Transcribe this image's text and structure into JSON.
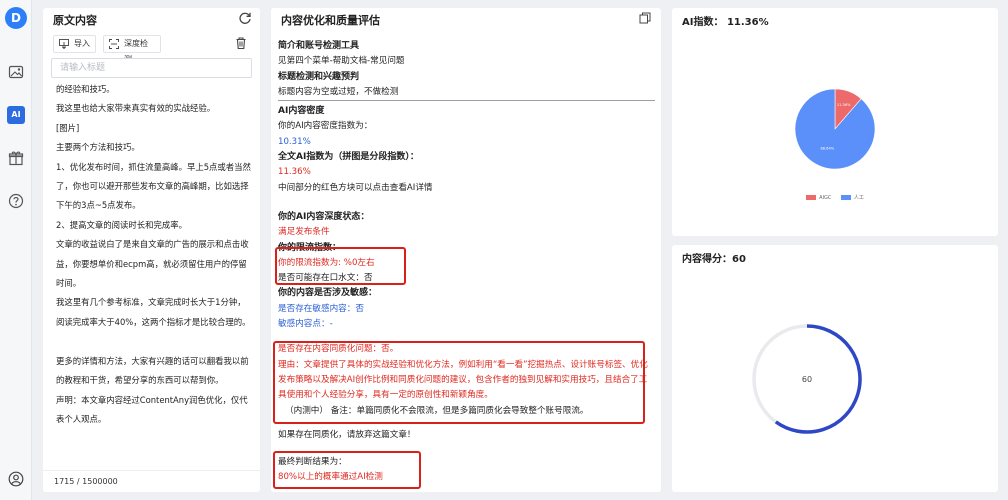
{
  "rail": {
    "logo_letter": "D",
    "icons": [
      "logo-icon",
      "image-icon",
      "ai-icon",
      "gift-icon",
      "help-icon",
      "user-icon"
    ],
    "ai_label": "AI"
  },
  "source": {
    "title": "原文内容",
    "import_label": "导入",
    "deep_check_label": "深度检测",
    "title_placeholder": "请输入标题",
    "paragraphs": [
      "的经验和技巧。",
      "我这里也给大家带来真实有效的实战经验。",
      "[图片]",
      "主要两个方法和技巧。",
      "1、优化发布时间，抓住流量高峰。早上5点或者当然了，你也可以避开那些发布文章的高峰期，比如选择下午的3点~5点发布。",
      "2、提高文章的阅读时长和完成率。",
      "文章的收益说白了是来自文章的广告的展示和点击收益，你要想单价和ecpm高，就必须留住用户的停留时间。",
      "我这里有几个参考标准，文章完成时长大于1分钟，阅读完成率大于40%，这两个指标才是比较合理的。",
      " ",
      "更多的详情和方法，大家有兴趣的话可以翻看我以前的教程和干货，希望分享的东西可以帮到你。",
      "声明：本文章内容经过ContentAny润色优化，仅代表个人观点。"
    ],
    "char_count": "1715 / 1500000"
  },
  "evaluation": {
    "title": "内容优化和质量评估",
    "intro_heading": "简介和账号检测工具",
    "intro_text": "见第四个菜单-帮助文档-常见问题",
    "title_check_heading": "标题检测和兴趣预判",
    "title_check_text": "标题内容为空或过短，不做检测",
    "ai_heading": "AI内容密度",
    "ai_density_label": "你的AI内容密度指数为：",
    "ai_density_value": "10.31%",
    "full_ai_label": "全文AI指数为（拼图是分段指数）：",
    "full_ai_value": "11.36%",
    "ai_hint": "中间部分的红色方块可以点击查看AI详情",
    "depth_heading": "你的AI内容深度状态：",
    "depth_status": "满足发布条件",
    "limit_heading": "你的限流指数：",
    "limit_value": "你的限流指数为: %0左右",
    "spoken_text": "是否可能存在口水文：否",
    "sensitive_heading": "你的内容是否涉及敏感：",
    "sensitive_exists": "是否存在敏感内容：否",
    "sensitive_points": "敏感内容点：-",
    "homog_question": "是否存在内容同质化问题：否。",
    "homog_reason": "理由：文章提供了具体的实战经验和优化方法，例如利用“看一看”挖掘热点、设计账号标签、优化发布策略以及解决AI创作比例和同质化问题的建议，包含作者的独到见解和实用技巧，且结合了工具使用和个人经验分享，具有一定的原创性和新颖角度。",
    "homog_note": "（内测中） 备注：单篇同质化不会限流，但是多篇同质化会导致整个账号限流。",
    "homog_advice": "如果存在同质化，请放弃这篇文章！",
    "final_heading": "最终判断结果为：",
    "final_value": "80%以上的概率通过AI检测"
  },
  "ai_index": {
    "title": "AI指数： 11.36%",
    "slices": [
      {
        "name": "AIGC",
        "value": 11.36,
        "label": "11.36%",
        "color": "#ee6a6a"
      },
      {
        "name": "人工",
        "value": 88.64,
        "label": "88.64%",
        "color": "#5b8ff9"
      }
    ]
  },
  "score": {
    "title": "内容得分：60",
    "value": 60,
    "max": 100,
    "label": "60",
    "color": "#2d47c7"
  }
}
